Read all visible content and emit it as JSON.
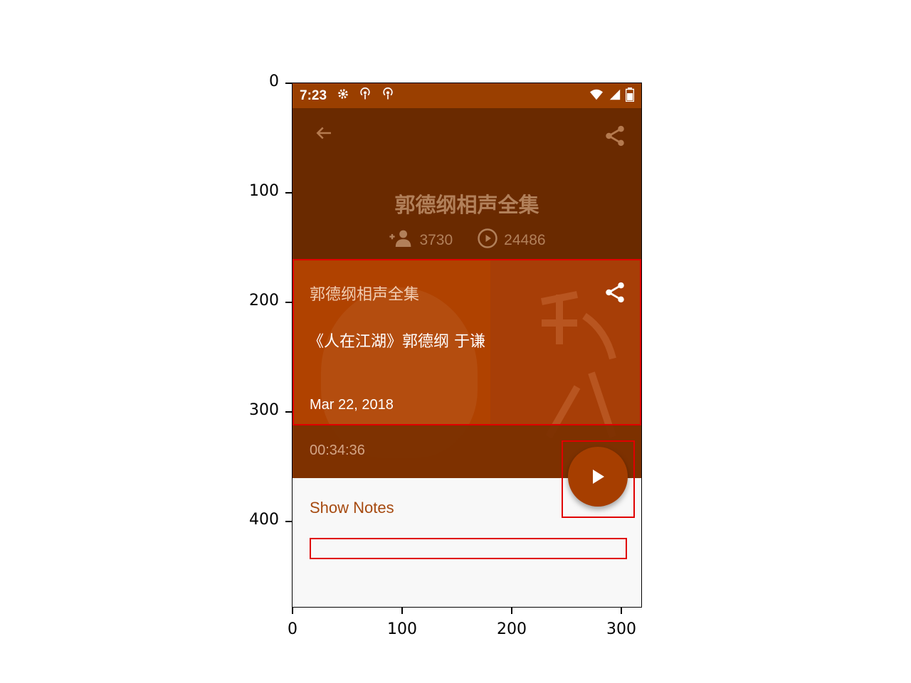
{
  "axes": {
    "y_ticks": [
      "0",
      "100",
      "200",
      "300",
      "400"
    ],
    "x_ticks": [
      "0",
      "100",
      "200",
      "300"
    ]
  },
  "status_bar": {
    "time": "7:23",
    "left_icons": [
      "gear-icon",
      "podcast-icon",
      "podcast-icon"
    ],
    "right_icons": [
      "wifi-icon",
      "signal-icon",
      "battery-icon"
    ]
  },
  "header": {
    "title": "郭德纲相声全集",
    "subscribers": "3730",
    "plays": "24486"
  },
  "episode_card": {
    "podcast_name": "郭德纲相声全集",
    "episode_title": "《人在江湖》郭德纲 于谦",
    "date": "Mar 22, 2018",
    "duration": "00:34:36"
  },
  "notes": {
    "title": "Show Notes",
    "content": ""
  },
  "colors": {
    "status_bar": "#9a3f00",
    "header_bg": "#6a2a00",
    "card_bg": "#b04200",
    "fab": "#a63e00",
    "accent_text": "#a64a10",
    "highlight_box": "#e00000"
  }
}
